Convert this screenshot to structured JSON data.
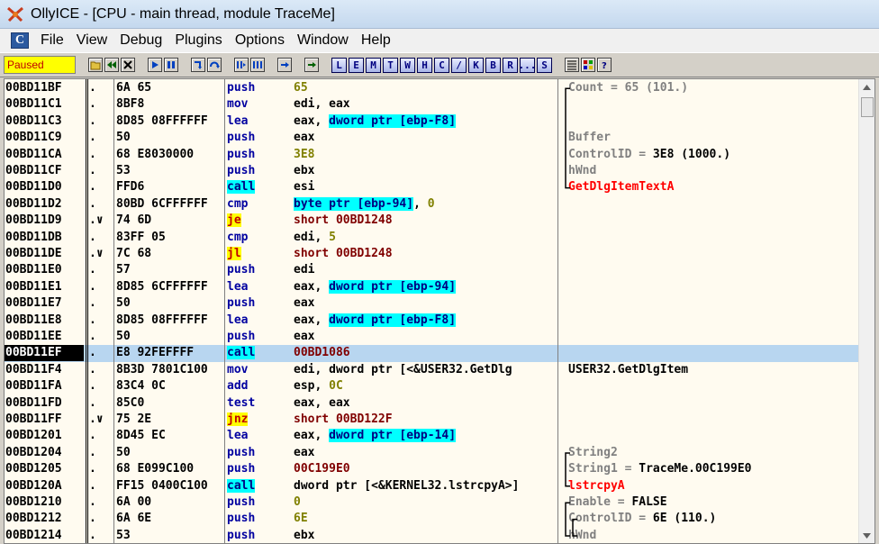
{
  "window": {
    "title": "OllyICE - [CPU - main thread, module TraceMe]"
  },
  "menu": [
    "File",
    "View",
    "Debug",
    "Plugins",
    "Options",
    "Window",
    "Help"
  ],
  "toolbar": {
    "status": "Paused",
    "letters": [
      "L",
      "E",
      "M",
      "T",
      "W",
      "H",
      "C",
      "/",
      "K",
      "B",
      "R",
      "...",
      "S"
    ]
  },
  "rows": [
    {
      "addr": "00BD11BF",
      "mark": ".",
      "hex": "6A 65",
      "mn": "push",
      "ops": [
        [
          "65",
          "k-olive"
        ]
      ],
      "cmt": [
        [
          "Count = 65 (101.)",
          "k-gray"
        ]
      ],
      "br": "top"
    },
    {
      "addr": "00BD11C1",
      "mark": ".",
      "hex": "8BF8",
      "mn": "mov",
      "ops": [
        [
          "edi, eax",
          ""
        ]
      ],
      "cmt": [],
      "br": "mid"
    },
    {
      "addr": "00BD11C3",
      "mark": ".",
      "hex": "8D85 08FFFFFF",
      "mn": "lea",
      "ops": [
        [
          "eax, ",
          ""
        ],
        [
          "dword ptr [ebp-F8]",
          "k-mem"
        ]
      ],
      "cmt": [],
      "br": "mid"
    },
    {
      "addr": "00BD11C9",
      "mark": ".",
      "hex": "50",
      "mn": "push",
      "ops": [
        [
          "eax",
          ""
        ]
      ],
      "cmt": [
        [
          "Buffer",
          "k-gray"
        ]
      ],
      "br": "mid"
    },
    {
      "addr": "00BD11CA",
      "mark": ".",
      "hex": "68 E8030000",
      "mn": "push",
      "ops": [
        [
          "3E8",
          "k-olive"
        ]
      ],
      "cmt": [
        [
          "ControlID = ",
          "k-gray"
        ],
        [
          "3E8 (1000.)",
          ""
        ]
      ],
      "br": "mid"
    },
    {
      "addr": "00BD11CF",
      "mark": ".",
      "hex": "53",
      "mn": "push",
      "ops": [
        [
          "ebx",
          ""
        ]
      ],
      "cmt": [
        [
          "hWnd",
          "k-gray"
        ]
      ],
      "br": "mid"
    },
    {
      "addr": "00BD11D0",
      "mark": ".",
      "hex": "FFD6",
      "mn": "call",
      "mnc": "k-call",
      "ops": [
        [
          "esi",
          ""
        ]
      ],
      "cmt": [
        [
          "GetDlgItemTextA",
          "k-red"
        ]
      ],
      "br": "bot"
    },
    {
      "addr": "00BD11D2",
      "mark": ".",
      "hex": "80BD 6CFFFFFF",
      "mn": "cmp",
      "ops": [
        [
          "byte ptr [ebp-94]",
          "k-mem"
        ],
        [
          ", ",
          ""
        ],
        [
          "0",
          "k-olive"
        ]
      ],
      "cmt": []
    },
    {
      "addr": "00BD11D9",
      "mark": ".∨",
      "hex": "74 6D",
      "mn": "je",
      "mnc": "k-hl",
      "ops": [
        [
          "short 00BD1248",
          "k-maroon"
        ]
      ],
      "cmt": []
    },
    {
      "addr": "00BD11DB",
      "mark": ".",
      "hex": "83FF 05",
      "mn": "cmp",
      "ops": [
        [
          "edi, ",
          ""
        ],
        [
          "5",
          "k-olive"
        ]
      ],
      "cmt": []
    },
    {
      "addr": "00BD11DE",
      "mark": ".∨",
      "hex": "7C 68",
      "mn": "jl",
      "mnc": "k-hl",
      "ops": [
        [
          "short 00BD1248",
          "k-maroon"
        ]
      ],
      "cmt": []
    },
    {
      "addr": "00BD11E0",
      "mark": ".",
      "hex": "57",
      "mn": "push",
      "ops": [
        [
          "edi",
          ""
        ]
      ],
      "cmt": []
    },
    {
      "addr": "00BD11E1",
      "mark": ".",
      "hex": "8D85 6CFFFFFF",
      "mn": "lea",
      "ops": [
        [
          "eax, ",
          ""
        ],
        [
          "dword ptr [ebp-94]",
          "k-mem"
        ]
      ],
      "cmt": []
    },
    {
      "addr": "00BD11E7",
      "mark": ".",
      "hex": "50",
      "mn": "push",
      "ops": [
        [
          "eax",
          ""
        ]
      ],
      "cmt": []
    },
    {
      "addr": "00BD11E8",
      "mark": ".",
      "hex": "8D85 08FFFFFF",
      "mn": "lea",
      "ops": [
        [
          "eax, ",
          ""
        ],
        [
          "dword ptr [ebp-F8]",
          "k-mem"
        ]
      ],
      "cmt": []
    },
    {
      "addr": "00BD11EE",
      "mark": ".",
      "hex": "50",
      "mn": "push",
      "ops": [
        [
          "eax",
          ""
        ]
      ],
      "cmt": []
    },
    {
      "addr": "00BD11EF",
      "mark": ".",
      "hex": "E8 92FEFFFF",
      "mn": "call",
      "mnc": "k-call",
      "ops": [
        [
          "00BD1086",
          "k-maroon"
        ]
      ],
      "cmt": [],
      "selected": true
    },
    {
      "addr": "00BD11F4",
      "mark": ".",
      "hex": "8B3D 7801C100",
      "mn": "mov",
      "ops": [
        [
          "edi, dword ptr [<&USER32.GetDlg",
          ""
        ]
      ],
      "cmt": [
        [
          "USER32.GetDlgItem",
          ""
        ]
      ]
    },
    {
      "addr": "00BD11FA",
      "mark": ".",
      "hex": "83C4 0C",
      "mn": "add",
      "ops": [
        [
          "esp, ",
          ""
        ],
        [
          "0C",
          "k-olive"
        ]
      ],
      "cmt": []
    },
    {
      "addr": "00BD11FD",
      "mark": ".",
      "hex": "85C0",
      "mn": "test",
      "ops": [
        [
          "eax, eax",
          ""
        ]
      ],
      "cmt": []
    },
    {
      "addr": "00BD11FF",
      "mark": ".∨",
      "hex": "75 2E",
      "mn": "jnz",
      "mnc": "k-hl",
      "ops": [
        [
          "short 00BD122F",
          "k-maroon"
        ]
      ],
      "cmt": []
    },
    {
      "addr": "00BD1201",
      "mark": ".",
      "hex": "8D45 EC",
      "mn": "lea",
      "ops": [
        [
          "eax, ",
          ""
        ],
        [
          "dword ptr [ebp-14]",
          "k-mem"
        ]
      ],
      "cmt": []
    },
    {
      "addr": "00BD1204",
      "mark": ".",
      "hex": "50",
      "mn": "push",
      "ops": [
        [
          "eax",
          ""
        ]
      ],
      "cmt": [
        [
          "String2",
          "k-gray"
        ]
      ],
      "br": "top"
    },
    {
      "addr": "00BD1205",
      "mark": ".",
      "hex": "68 E099C100",
      "mn": "push",
      "ops": [
        [
          "00C199E0",
          "k-maroon"
        ]
      ],
      "cmt": [
        [
          "String1 = ",
          "k-gray"
        ],
        [
          "TraceMe.00C199E0",
          ""
        ]
      ],
      "br": "mid"
    },
    {
      "addr": "00BD120A",
      "mark": ".",
      "hex": "FF15 0400C100",
      "mn": "call",
      "mnc": "k-call",
      "ops": [
        [
          "dword ptr [<&KERNEL32.lstrcpyA>]",
          ""
        ]
      ],
      "cmt": [
        [
          "lstrcpyA",
          "k-red"
        ]
      ],
      "br": "bot"
    },
    {
      "addr": "00BD1210",
      "mark": ".",
      "hex": "6A 00",
      "mn": "push",
      "ops": [
        [
          "0",
          "k-olive"
        ]
      ],
      "cmt": [
        [
          "Enable = ",
          "k-gray"
        ],
        [
          "FALSE",
          ""
        ]
      ],
      "br": "top"
    },
    {
      "addr": "00BD1212",
      "mark": ".",
      "hex": "6A 6E",
      "mn": "push",
      "ops": [
        [
          "6E",
          "k-olive"
        ]
      ],
      "cmt": [
        [
          "ControlID = ",
          "k-gray"
        ],
        [
          "6E (110.)",
          ""
        ]
      ],
      "br": "mid",
      "br2": "top"
    },
    {
      "addr": "00BD1214",
      "mark": ".",
      "hex": "53",
      "mn": "push",
      "ops": [
        [
          "ebx",
          ""
        ]
      ],
      "cmt": [
        [
          "hWnd",
          "k-gray"
        ]
      ],
      "br": "mid",
      "br2": "mid"
    }
  ]
}
